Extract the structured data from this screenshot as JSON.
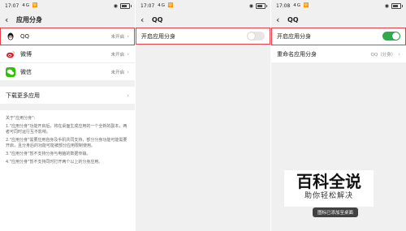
{
  "panels": [
    {
      "status": {
        "time": "17:07",
        "signal": "4G 🛜"
      },
      "title": "应用分身",
      "apps": [
        {
          "name": "QQ",
          "status": "未开启",
          "icon": "qq-icon"
        },
        {
          "name": "微博",
          "status": "未开启",
          "icon": "weibo-icon"
        },
        {
          "name": "微信",
          "status": "未开启",
          "icon": "wechat-icon"
        }
      ],
      "download_more": "下载更多应用",
      "notes_title": "关于\"应用分身\":",
      "notes": [
        "1.\"应用分身\"功能开启后，将在桌面生成应用的一个全新的副本，两者可同时运行互不影响。",
        "2.\"应用分身\"需要应用自身及手机共同支持，部分分身功能可能需要开启，且分身后的功能可能被部分应用限制使用。",
        "3.\"应用分身\"暂不支持分身与电脑的数据传输。",
        "4.\"应用分身\"暂不支持同时打开两个以上的分身应用。"
      ]
    },
    {
      "status": {
        "time": "17:07",
        "signal": "4G 🛜"
      },
      "title": "QQ",
      "toggle_label": "开启应用分身",
      "toggle_state": "off"
    },
    {
      "status": {
        "time": "17:08",
        "signal": "4G 🛜"
      },
      "title": "QQ",
      "toggle_label": "开启应用分身",
      "toggle_state": "on",
      "rename_label": "重命名应用分身",
      "rename_value": "QQ（分身）"
    }
  ],
  "watermark": {
    "main": "百科全说",
    "sub": "助你轻松解决"
  },
  "toast": "图标已添加至桌面",
  "colors": {
    "highlight": "#e0414a",
    "toggle_on": "#2faa4c"
  }
}
